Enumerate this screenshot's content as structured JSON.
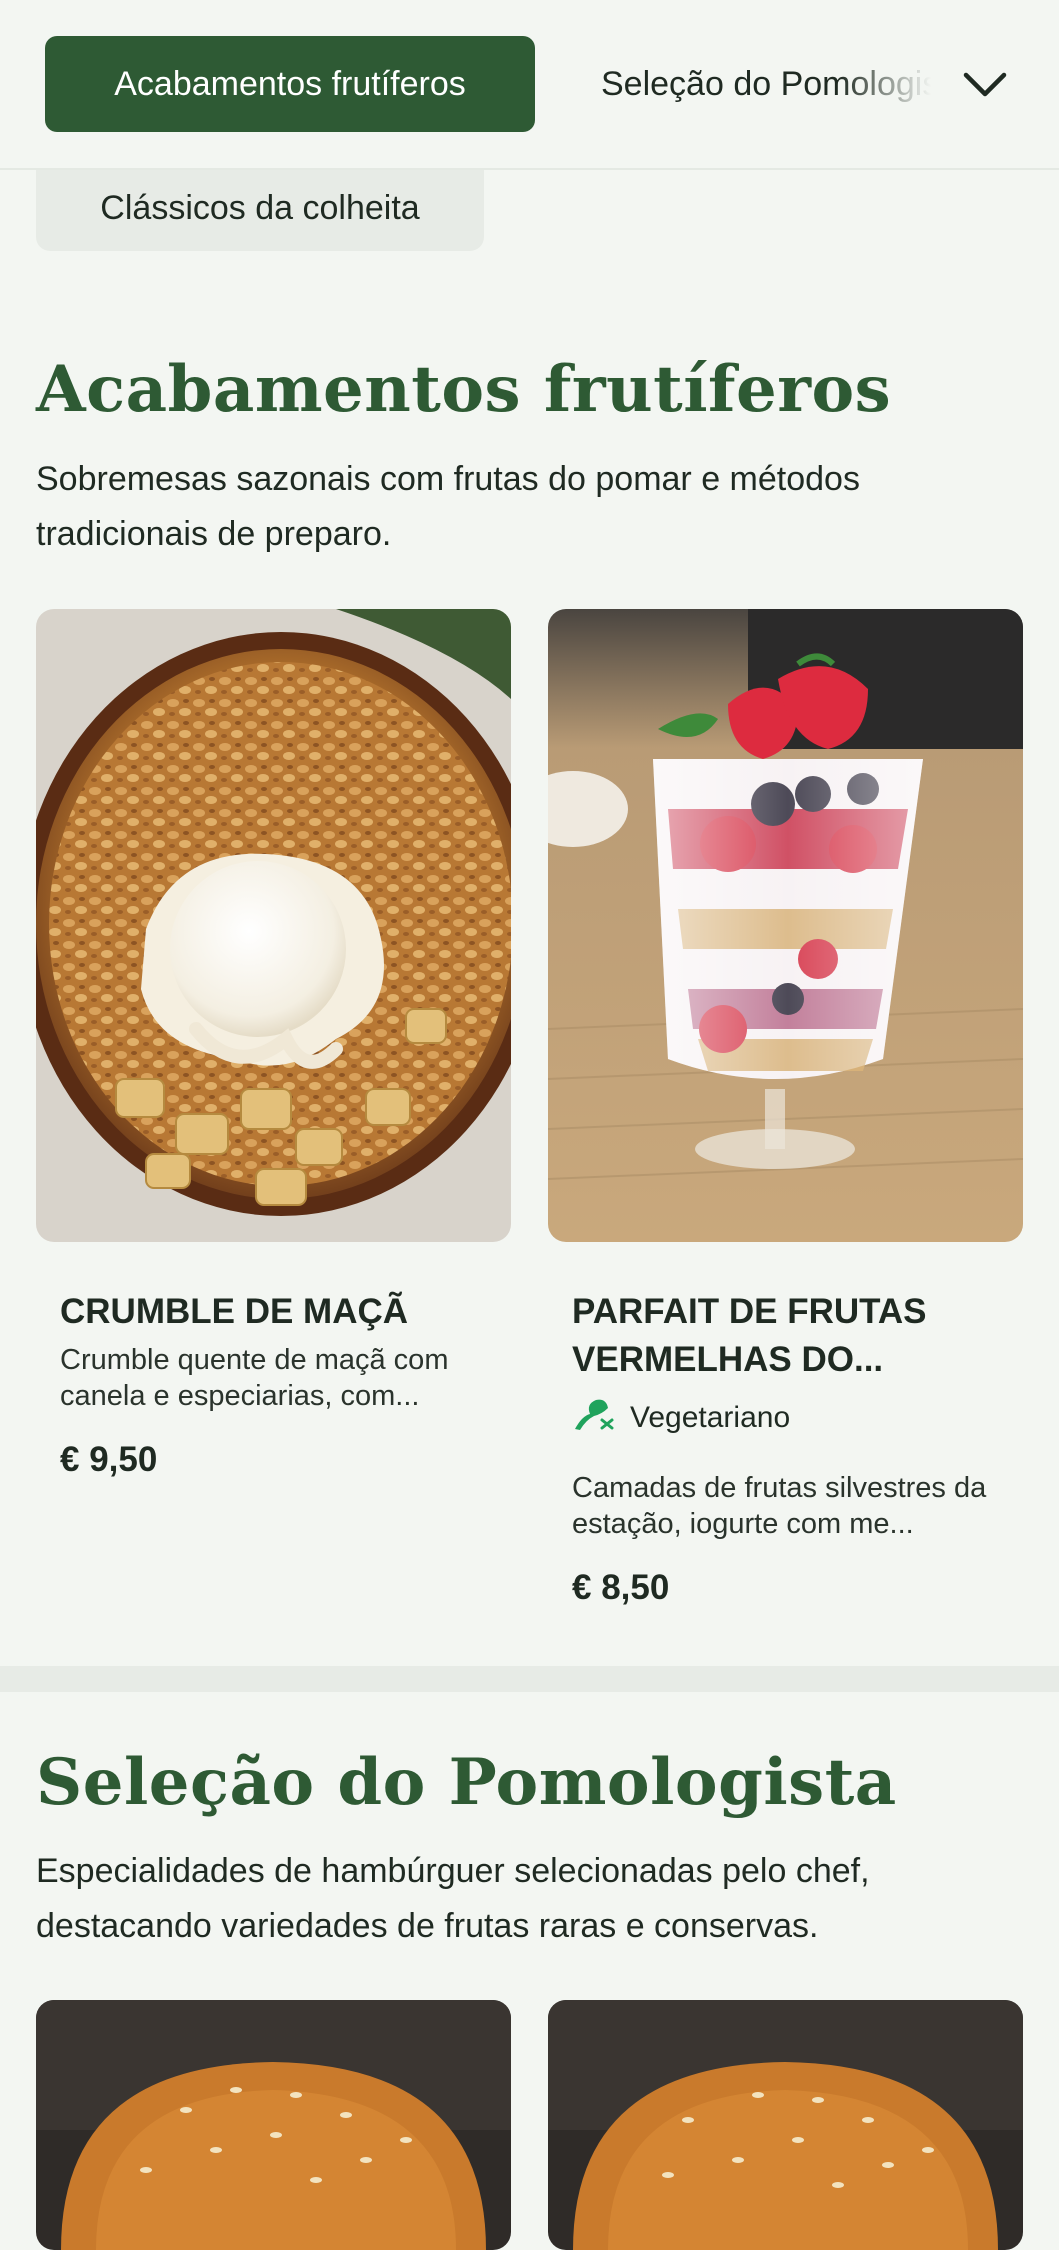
{
  "nav": {
    "active_tab": "Acabamentos frutíferos",
    "next_tab": "Seleção do Pomologista",
    "expand_icon": "chevron-down-icon",
    "chip": "Clássicos da colheita"
  },
  "sections": [
    {
      "title": "Acabamentos frutíferos",
      "description": "Sobremesas sazonais com frutas do pomar e métodos tradicionais de preparo.",
      "items": [
        {
          "name": "CRUMBLE DE MAÇÃ",
          "description": "Crumble quente de maçã com canela e especiarias, com...",
          "price": "€ 9,50"
        },
        {
          "name": "PARFAIT DE FRUTAS VERMELHAS DO...",
          "badge": "Vegetariano",
          "badge_icon": "vegetarian-icon",
          "description": "Camadas de frutas silvestres da estação, iogurte com me...",
          "price": "€ 8,50"
        }
      ]
    },
    {
      "title": "Seleção do Pomologista",
      "description": "Especialidades de hambúrguer selecionadas pelo chef, destacando variedades de frutas raras e conservas."
    }
  ],
  "colors": {
    "brand_green": "#2e5a34",
    "background": "#f3f6f2",
    "veg_icon": "#1fa35c"
  }
}
